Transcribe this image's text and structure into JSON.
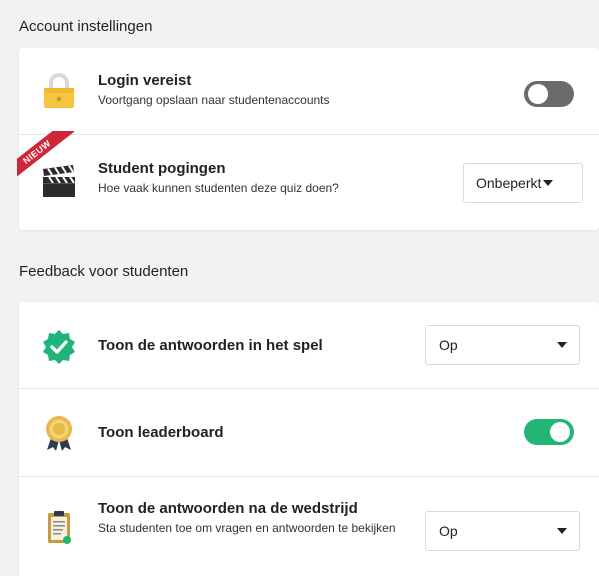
{
  "account": {
    "heading": "Account instellingen",
    "login": {
      "title": "Login vereist",
      "subtitle": "Voortgang opslaan naar studentenaccounts",
      "enabled": false,
      "icon": "lock-icon"
    },
    "attempts": {
      "title": "Student pogingen",
      "subtitle": "Hoe vaak kunnen studenten deze quiz doen?",
      "value": "Onbeperkt",
      "badge": "NIEUW",
      "icon": "clapperboard-icon"
    }
  },
  "feedback": {
    "heading": "Feedback voor studenten",
    "show_answers_in_game": {
      "title": "Toon de antwoorden in het spel",
      "value": "Op",
      "icon": "check-badge-icon"
    },
    "leaderboard": {
      "title": "Toon leaderboard",
      "enabled": true,
      "icon": "medal-icon"
    },
    "show_answers_after": {
      "title": "Toon de antwoorden na de wedstrijd",
      "subtitle": "Sta studenten toe om vragen en antwoorden te bekijken",
      "value": "Op",
      "icon": "clipboard-icon"
    }
  },
  "colors": {
    "toggle_on": "#22b573",
    "toggle_off": "#6b6b6b",
    "badge": "#d0263a",
    "check_badge": "#1fb479"
  }
}
